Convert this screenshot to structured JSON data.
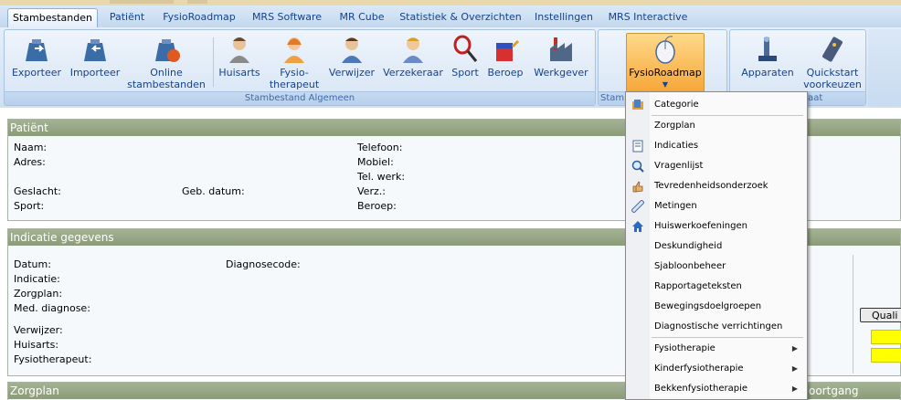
{
  "tabs": [
    "Stambestanden",
    "Patiënt",
    "FysioRoadmap",
    "MRS Software",
    "MR Cube",
    "Statistiek & Overzichten",
    "Instellingen",
    "MRS Interactive"
  ],
  "ribbon": {
    "group1": {
      "buttons": [
        "Exporteer",
        "Importeer",
        "Online stambestanden",
        "Huisarts",
        "Fysio-therapeut",
        "Verwijzer",
        "Verzekeraar",
        "Sport",
        "Beroep",
        "Werkgever"
      ],
      "label": "Stambestand Algemeen"
    },
    "group2": {
      "label_partial": "Stamb",
      "button": "FysioRoadmap"
    },
    "group3": {
      "buttons": [
        "Apparaten",
        "Quickstart voorkeuzen"
      ],
      "label_partial": "apparaat"
    }
  },
  "patient": {
    "header": "Patiënt",
    "naam": "Naam:",
    "adres": "Adres:",
    "geslacht": "Geslacht:",
    "sport": "Sport:",
    "gebdatum": "Geb. datum:",
    "telefoon": "Telefoon:",
    "mobiel": "Mobiel:",
    "telwerk": "Tel. werk:",
    "verz": "Verz.:",
    "beroep": "Beroep:"
  },
  "indicatie": {
    "header": "Indicatie gegevens",
    "datum": "Datum:",
    "indicatie": "Indicatie:",
    "zorgplan": "Zorgplan:",
    "meddiagnose": "Med. diagnose:",
    "verwijzer": "Verwijzer:",
    "huisarts": "Huisarts:",
    "fysio": "Fysiotherapeut:",
    "diagnosecode": "Diagnosecode:",
    "qualibutton": "Quali"
  },
  "zorgplan": {
    "header": "Zorgplan",
    "voortgang": "oortgang"
  },
  "menu": {
    "items": [
      "Categorie",
      "Zorgplan",
      "Indicaties",
      "Vragenlijst",
      "Tevredenheidsonderzoek",
      "Metingen",
      "Huiswerkoefeningen",
      "Deskundigheid",
      "Sjabloonbeheer",
      "Rapportageteksten",
      "Bewegingsdoelgroepen",
      "Diagnostische verrichtingen",
      "Fysiotherapie",
      "Kinderfysiotherapie",
      "Bekkenfysiotherapie"
    ],
    "submenu_arrow": "▶"
  },
  "colors": {
    "accent_blue": "#15428b",
    "section_header": "#8b9c7a",
    "hot_button": "#f6a638"
  }
}
